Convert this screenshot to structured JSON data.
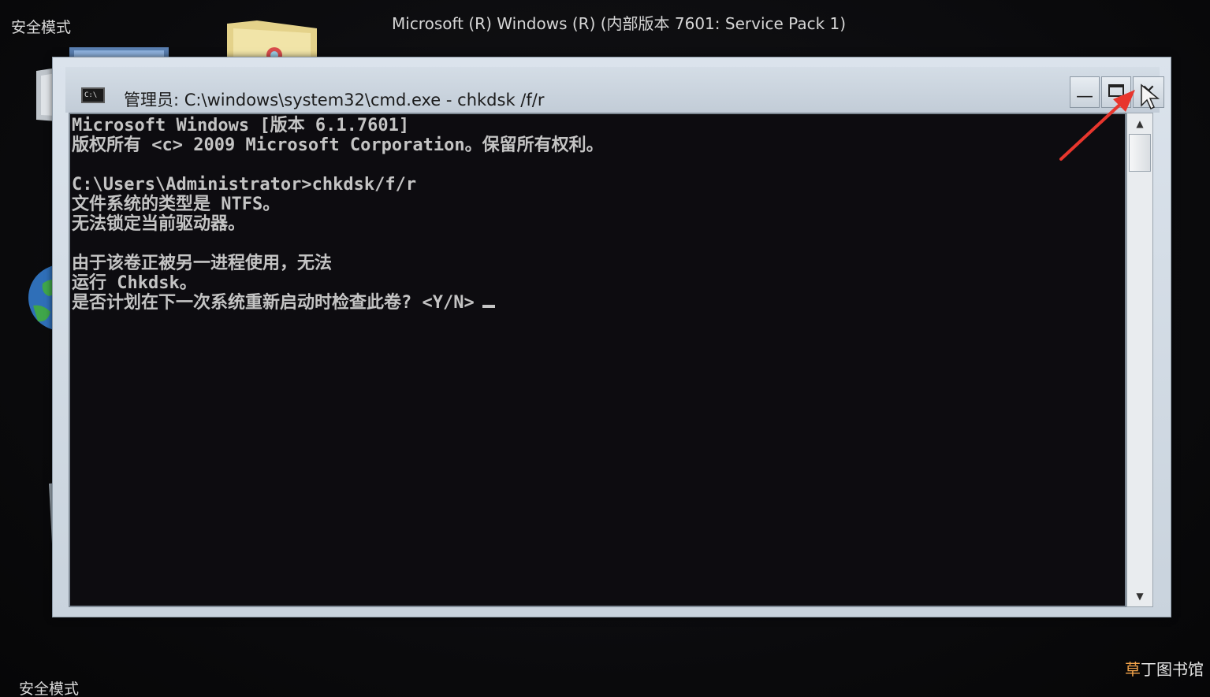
{
  "desktop": {
    "safe_mode_top": "安全模式",
    "safe_mode_bottom": "安全模式",
    "os_banner": "Microsoft (R) Windows (R) (内部版本 7601: Service Pack 1)",
    "watermark": {
      "glyph": "草",
      "text": "丁图书馆"
    },
    "icons": [
      "computer-icon",
      "folder-icon",
      "globe-icon",
      "recycle-bin-icon"
    ]
  },
  "window": {
    "icon_text": "C:\\",
    "title": "管理员: C:\\windows\\system32\\cmd.exe - chkdsk /f/r",
    "buttons": {
      "minimize": "—",
      "close": "✕"
    }
  },
  "console": {
    "lines": [
      "Microsoft Windows [版本 6.1.7601]",
      "版权所有 <c> 2009 Microsoft Corporation。保留所有权利。",
      "",
      "C:\\Users\\Administrator>chkdsk/f/r",
      "文件系统的类型是 NTFS。",
      "无法锁定当前驱动器。",
      "",
      "由于该卷正被另一进程使用，无法",
      "运行 Chkdsk。",
      "是否计划在下一次系统重新启动时检查此卷? <Y/N>"
    ]
  },
  "scrollbar": {
    "up_arrow": "▲",
    "down_arrow": "▼"
  },
  "colors": {
    "console_bg": "#0d0c10",
    "console_text": "#c4c4c4",
    "window_frame": "#c9d3dd",
    "annotation_arrow": "#e8362d"
  }
}
